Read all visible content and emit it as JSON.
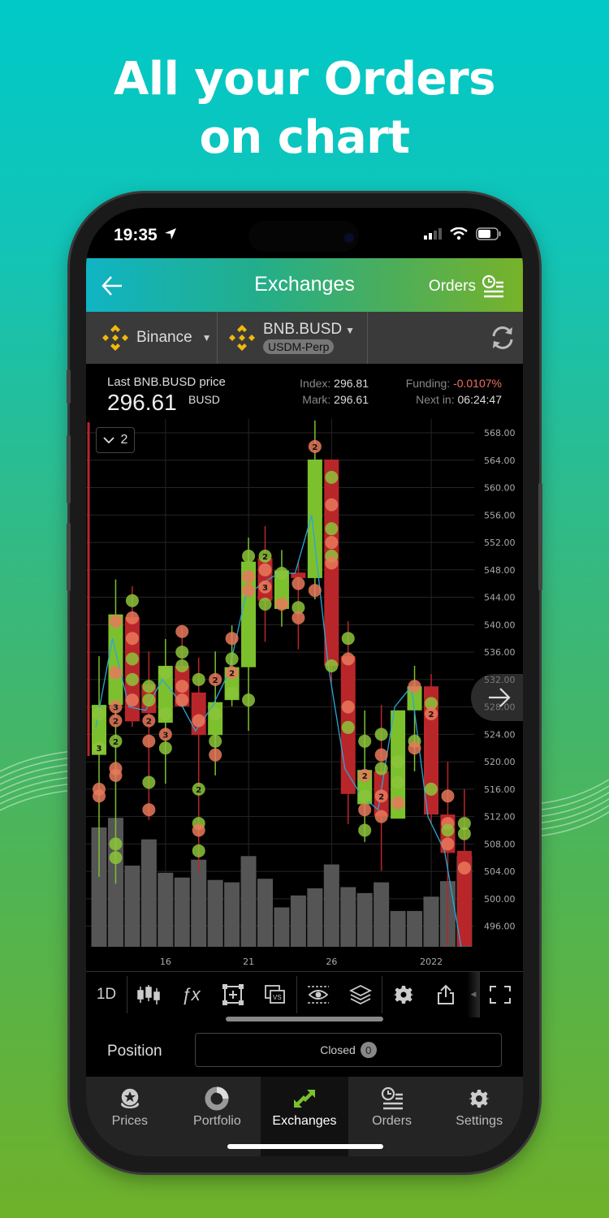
{
  "promo": {
    "headline_line1": "All your Orders",
    "headline_line2": "on chart"
  },
  "status_bar": {
    "time": "19:35"
  },
  "navbar": {
    "title": "Exchanges",
    "back_icon": "arrow-left-icon",
    "orders_label": "Orders",
    "orders_icon": "orders-list-icon"
  },
  "selector": {
    "exchange": "Binance",
    "pair": "BNB.BUSD",
    "market_type": "USDM-Perp",
    "refresh_icon": "refresh-icon"
  },
  "price_info": {
    "last_label": "Last BNB.BUSD price",
    "last_price": "296.61",
    "unit": "BUSD",
    "index_label": "Index:",
    "index_value": "296.81",
    "mark_label": "Mark:",
    "mark_value": "296.61",
    "funding_label": "Funding:",
    "funding_value": "-0.0107%",
    "next_label": "Next in:",
    "next_value": "06:24:47"
  },
  "chart_controls": {
    "series_toggle_count": "2"
  },
  "colors": {
    "up": "#7cc02e",
    "down": "#b9262a",
    "line": "#2aa7d6",
    "buy_marker": "#8cc43a",
    "sell_marker": "#e8795a",
    "volume": "#555555",
    "funding_negative": "#f07060"
  },
  "chart_data": {
    "type": "candlestick",
    "title": "",
    "xlabel": "",
    "ylabel": "",
    "ylim": [
      492,
      570
    ],
    "y_ticks": [
      "568.00",
      "564.00",
      "560.00",
      "556.00",
      "552.00",
      "548.00",
      "544.00",
      "540.00",
      "536.00",
      "532.00",
      "528.00",
      "524.00",
      "520.00",
      "516.00",
      "512.00",
      "508.00",
      "504.00",
      "500.00",
      "496.00"
    ],
    "x_ticks": [
      {
        "label": "16",
        "index": 2
      },
      {
        "label": "21",
        "index": 7
      },
      {
        "label": "26",
        "index": 12
      },
      {
        "label": "2022",
        "index": 18
      }
    ],
    "grid": true,
    "candles": [
      {
        "o": 521.0,
        "h": 535.4,
        "l": 503.2,
        "c": 528.3,
        "v": 1.0,
        "orders": [
          {
            "p": 527,
            "s": "buy"
          },
          {
            "p": 522,
            "s": "buy",
            "n": 3
          },
          {
            "p": 516,
            "s": "sell"
          },
          {
            "p": 515,
            "s": "sell"
          }
        ]
      },
      {
        "o": 528.3,
        "h": 546.6,
        "l": 502.2,
        "c": 541.5,
        "v": 1.08,
        "orders": [
          {
            "p": 540.5,
            "s": "sell"
          },
          {
            "p": 533,
            "s": "sell"
          },
          {
            "p": 528,
            "s": "sell",
            "n": 3
          },
          {
            "p": 526,
            "s": "sell",
            "n": 2
          },
          {
            "p": 523,
            "s": "buy",
            "n": 2
          },
          {
            "p": 519,
            "s": "sell"
          },
          {
            "p": 518,
            "s": "sell"
          },
          {
            "p": 508,
            "s": "buy"
          },
          {
            "p": 506,
            "s": "buy"
          }
        ]
      },
      {
        "o": 541.1,
        "h": 545.6,
        "l": 525.1,
        "c": 525.9,
        "v": 0.68,
        "orders": [
          {
            "p": 543.5,
            "s": "buy"
          },
          {
            "p": 541,
            "s": "sell"
          },
          {
            "p": 538,
            "s": "sell"
          },
          {
            "p": 535,
            "s": "buy"
          },
          {
            "p": 532,
            "s": "buy"
          },
          {
            "p": 529,
            "s": "sell"
          }
        ]
      },
      {
        "o": 531.3,
        "h": 536.1,
        "l": 511.5,
        "c": 527.1,
        "v": 0.9,
        "orders": [
          {
            "p": 531,
            "s": "buy"
          },
          {
            "p": 529,
            "s": "buy"
          },
          {
            "p": 526,
            "s": "sell",
            "n": 2
          },
          {
            "p": 523,
            "s": "sell"
          },
          {
            "p": 517,
            "s": "buy"
          },
          {
            "p": 513,
            "s": "sell"
          }
        ]
      },
      {
        "o": 525.7,
        "h": 537.9,
        "l": 516.8,
        "c": 534.0,
        "v": 0.62,
        "orders": [
          {
            "p": 533,
            "s": "buy"
          },
          {
            "p": 527,
            "s": "buy"
          },
          {
            "p": 524,
            "s": "sell",
            "n": 3
          },
          {
            "p": 522,
            "s": "buy"
          }
        ]
      },
      {
        "o": 534.0,
        "h": 539.7,
        "l": 529.8,
        "c": 528.1,
        "v": 0.58,
        "orders": [
          {
            "p": 539,
            "s": "sell"
          },
          {
            "p": 536,
            "s": "buy"
          },
          {
            "p": 534,
            "s": "buy"
          },
          {
            "p": 531,
            "s": "sell"
          },
          {
            "p": 529,
            "s": "sell"
          }
        ]
      },
      {
        "o": 530.1,
        "h": 535.2,
        "l": 503.8,
        "c": 523.9,
        "v": 0.73,
        "orders": [
          {
            "p": 532,
            "s": "buy"
          },
          {
            "p": 526,
            "s": "sell"
          },
          {
            "p": 516,
            "s": "buy",
            "n": 2
          },
          {
            "p": 511,
            "s": "buy"
          },
          {
            "p": 510,
            "s": "sell"
          },
          {
            "p": 507,
            "s": "buy"
          }
        ]
      },
      {
        "o": 523.9,
        "h": 536.1,
        "l": 518.0,
        "c": 528.7,
        "v": 0.56,
        "orders": [
          {
            "p": 532,
            "s": "sell",
            "n": 2
          },
          {
            "p": 527,
            "s": "buy"
          },
          {
            "p": 523,
            "s": "buy"
          },
          {
            "p": 521,
            "s": "sell"
          }
        ]
      },
      {
        "o": 529.0,
        "h": 539.9,
        "l": 528.1,
        "c": 533.8,
        "v": 0.54,
        "orders": [
          {
            "p": 538,
            "s": "sell"
          },
          {
            "p": 535,
            "s": "buy"
          },
          {
            "p": 533,
            "s": "sell",
            "n": 2
          },
          {
            "p": 530,
            "s": "buy"
          }
        ]
      },
      {
        "o": 533.8,
        "h": 552.7,
        "l": 524.5,
        "c": 549.2,
        "v": 0.76,
        "orders": [
          {
            "p": 550,
            "s": "buy"
          },
          {
            "p": 547,
            "s": "sell"
          },
          {
            "p": 545,
            "s": "sell"
          },
          {
            "p": 529,
            "s": "buy"
          }
        ]
      },
      {
        "o": 549.7,
        "h": 554.4,
        "l": 537.5,
        "c": 543.5,
        "v": 0.57,
        "orders": [
          {
            "p": 550,
            "s": "buy",
            "n": 2
          },
          {
            "p": 548,
            "s": "sell"
          },
          {
            "p": 545.5,
            "s": "sell",
            "n": 3
          },
          {
            "p": 543,
            "s": "buy"
          }
        ]
      },
      {
        "o": 542.3,
        "h": 550.9,
        "l": 539.7,
        "c": 547.9,
        "v": 0.33,
        "orders": [
          {
            "p": 547.5,
            "s": "buy"
          },
          {
            "p": 543,
            "s": "sell"
          }
        ]
      },
      {
        "o": 547.6,
        "h": 549.4,
        "l": 536.4,
        "c": 546.8,
        "v": 0.43,
        "orders": [
          {
            "p": 546,
            "s": "sell"
          },
          {
            "p": 542.5,
            "s": "buy"
          },
          {
            "p": 541,
            "s": "sell"
          }
        ]
      },
      {
        "o": 546.8,
        "h": 569.8,
        "l": 543.7,
        "c": 564.1,
        "v": 0.49,
        "orders": [
          {
            "p": 566,
            "s": "sell",
            "n": 2
          },
          {
            "p": 545,
            "s": "sell"
          }
        ]
      },
      {
        "o": 564.1,
        "h": 564.1,
        "l": 531.6,
        "c": 534.0,
        "v": 0.69,
        "orders": [
          {
            "p": 561.5,
            "s": "buy"
          },
          {
            "p": 557.5,
            "s": "sell"
          },
          {
            "p": 554,
            "s": "buy"
          },
          {
            "p": 552,
            "s": "sell"
          },
          {
            "p": 550,
            "s": "buy"
          },
          {
            "p": 549,
            "s": "sell"
          },
          {
            "p": 534,
            "s": "buy"
          }
        ]
      },
      {
        "o": 535.4,
        "h": 540.5,
        "l": 510.9,
        "c": 515.3,
        "v": 0.5,
        "orders": [
          {
            "p": 538,
            "s": "buy"
          },
          {
            "p": 535,
            "s": "sell"
          },
          {
            "p": 528,
            "s": "sell"
          },
          {
            "p": 525,
            "s": "buy"
          }
        ]
      },
      {
        "o": 513.8,
        "h": 527.5,
        "l": 508.3,
        "c": 518.8,
        "v": 0.45,
        "orders": [
          {
            "p": 523,
            "s": "buy"
          },
          {
            "p": 518,
            "s": "sell",
            "n": 2
          },
          {
            "p": 515,
            "s": "buy"
          },
          {
            "p": 513,
            "s": "sell"
          },
          {
            "p": 510,
            "s": "buy"
          }
        ]
      },
      {
        "o": 518.6,
        "h": 528.3,
        "l": 504.1,
        "c": 512.1,
        "v": 0.54,
        "orders": [
          {
            "p": 524,
            "s": "buy"
          },
          {
            "p": 521,
            "s": "sell"
          },
          {
            "p": 519,
            "s": "buy"
          },
          {
            "p": 515,
            "s": "sell",
            "n": 2
          },
          {
            "p": 512,
            "s": "sell"
          }
        ]
      },
      {
        "o": 511.7,
        "h": 527.5,
        "l": 511.7,
        "c": 527.5,
        "v": 0.3,
        "orders": [
          {
            "p": 520,
            "s": "buy"
          },
          {
            "p": 517,
            "s": "buy"
          },
          {
            "p": 514,
            "s": "sell"
          }
        ]
      },
      {
        "o": 527.5,
        "h": 534.0,
        "l": 518.6,
        "c": 531.0,
        "v": 0.3,
        "orders": [
          {
            "p": 531,
            "s": "sell"
          },
          {
            "p": 523,
            "s": "buy"
          },
          {
            "p": 522,
            "s": "sell"
          }
        ]
      },
      {
        "o": 531.0,
        "h": 532.8,
        "l": 510.9,
        "c": 512.3,
        "v": 0.42,
        "orders": [
          {
            "p": 528.5,
            "s": "buy"
          },
          {
            "p": 527,
            "s": "sell",
            "n": 2
          },
          {
            "p": 516,
            "s": "buy"
          }
        ]
      },
      {
        "o": 512.3,
        "h": 520.0,
        "l": 493.1,
        "c": 506.7,
        "v": 0.55,
        "orders": [
          {
            "p": 515,
            "s": "sell"
          },
          {
            "p": 511,
            "s": "sell"
          },
          {
            "p": 510,
            "s": "buy"
          },
          {
            "p": 508,
            "s": "sell"
          }
        ]
      },
      {
        "o": 507.0,
        "h": 516.0,
        "l": 493.1,
        "c": 493.1,
        "v": 0.76,
        "orders": [
          {
            "p": 511,
            "s": "buy"
          },
          {
            "p": 509.5,
            "s": "buy"
          },
          {
            "p": 504.5,
            "s": "sell"
          }
        ]
      }
    ],
    "price_line": [
      525,
      538,
      528,
      527.5,
      532,
      529,
      524.5,
      528,
      533,
      544,
      546,
      547.5,
      547.5,
      556,
      534,
      519,
      515,
      513,
      528,
      531,
      512,
      507,
      493
    ]
  },
  "toolbar": {
    "interval": "1D",
    "items": [
      "candles-icon",
      "fx-icon",
      "add-frame-icon",
      "compare-vs-icon",
      "visibility-icon",
      "layers-icon",
      "gear-icon",
      "share-icon",
      "fullscreen-icon"
    ]
  },
  "position": {
    "label": "Position",
    "status": "Closed",
    "count": "0"
  },
  "tabbar": {
    "items": [
      {
        "label": "Prices",
        "icon": "coins-star-icon",
        "active": false
      },
      {
        "label": "Portfolio",
        "icon": "pie-chart-icon",
        "active": false
      },
      {
        "label": "Exchanges",
        "icon": "exchange-arrows-icon",
        "active": true
      },
      {
        "label": "Orders",
        "icon": "orders-list-icon",
        "active": false
      },
      {
        "label": "Settings",
        "icon": "gear-icon",
        "active": false
      }
    ]
  }
}
